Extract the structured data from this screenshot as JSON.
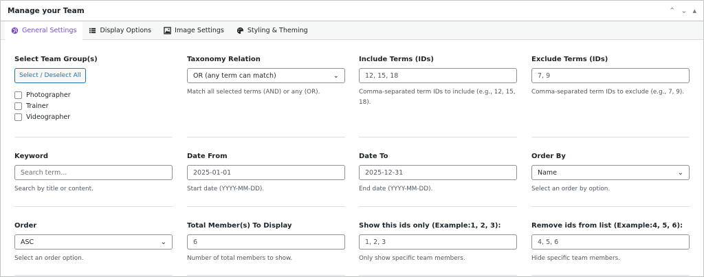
{
  "header": {
    "title": "Manage your Team"
  },
  "tabs": [
    {
      "label": "General Settings",
      "icon": "globe-icon",
      "active": true
    },
    {
      "label": "Display Options",
      "icon": "list-icon",
      "active": false
    },
    {
      "label": "Image Settings",
      "icon": "image-icon",
      "active": false
    },
    {
      "label": "Styling & Theming",
      "icon": "palette-icon",
      "active": false
    }
  ],
  "fields": {
    "team_group": {
      "label": "Select Team Group(s)",
      "button": "Select / Deselect All",
      "options": [
        "Photographer",
        "Trainer",
        "Videographer"
      ]
    },
    "taxonomy": {
      "label": "Taxonomy Relation",
      "value": "OR (any term can match)",
      "desc": "Match all selected terms (AND) or any (OR)."
    },
    "include": {
      "label": "Include Terms (IDs)",
      "value": "12, 15, 18",
      "desc": "Comma-separated term IDs to include (e.g., 12, 15, 18)."
    },
    "exclude": {
      "label": "Exclude Terms (IDs)",
      "value": "7, 9",
      "desc": "Comma-separated term IDs to exclude (e.g., 7, 9)."
    },
    "keyword": {
      "label": "Keyword",
      "placeholder": "Search term...",
      "desc": "Search by title or content."
    },
    "date_from": {
      "label": "Date From",
      "value": "2025-01-01",
      "desc": "Start date (YYYY-MM-DD)."
    },
    "date_to": {
      "label": "Date To",
      "value": "2025-12-31",
      "desc": "End date (YYYY-MM-DD)."
    },
    "order_by": {
      "label": "Order By",
      "value": "Name",
      "desc": "Select an order by option."
    },
    "order": {
      "label": "Order",
      "value": "ASC",
      "desc": "Select an order option."
    },
    "total": {
      "label": "Total Member(s) To Display",
      "value": "6",
      "desc": "Number of total members to show."
    },
    "show_ids": {
      "label": "Show this ids only (Example:1, 2, 3):",
      "value": "1, 2, 3",
      "desc": "Only show specific team members."
    },
    "remove_ids": {
      "label": "Remove ids from list (Example:4, 5, 6):",
      "value": "4, 5, 6",
      "desc": "Hide specific team members."
    }
  },
  "colors": {
    "accent": "#7b4fcf",
    "link": "#2271b1"
  }
}
